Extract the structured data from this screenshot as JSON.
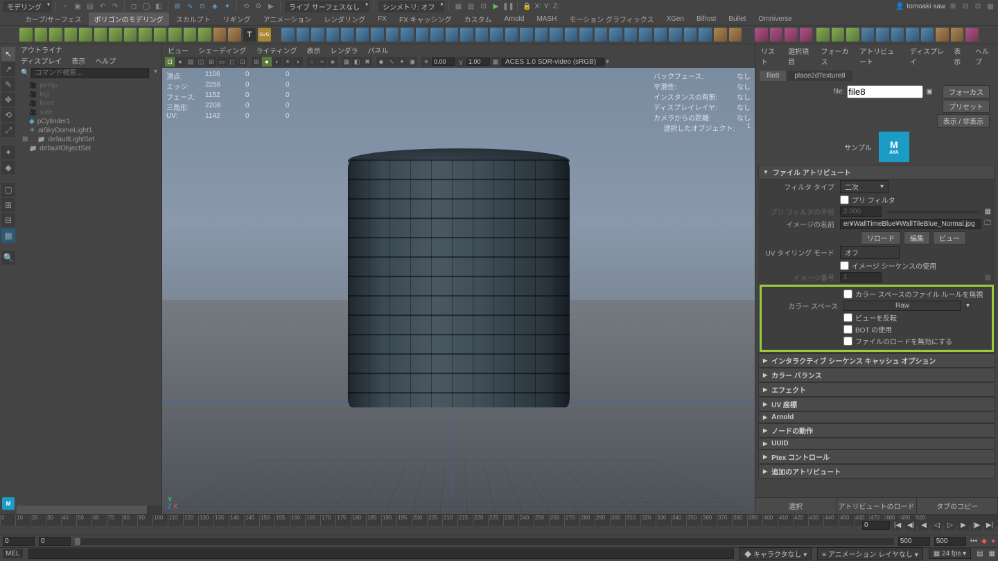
{
  "top": {
    "workspace": "モデリング",
    "surfaceMode": "ライブ サーフェスなし",
    "symmetry": "シンメトリ: オフ",
    "coordX": "X:",
    "coordY": "Y:",
    "coordZ": "Z:",
    "user": "tomoaki saw"
  },
  "menus": [
    "カーブ/サーフェス",
    "ポリゴンのモデリング",
    "スカルプト",
    "リギング",
    "アニメーション",
    "レンダリング",
    "FX",
    "FX キャッシング",
    "カスタム",
    "Arnold",
    "MASH",
    "モーション グラフィックス",
    "XGen",
    "Bifrost",
    "Bullet",
    "Omniverse"
  ],
  "menusActive": 1,
  "outliner": {
    "title": "アウトライナ",
    "menu": [
      "ディスプレイ",
      "表示",
      "ヘルプ"
    ],
    "searchPlaceholder": "コマンド検索...",
    "items": [
      {
        "icon": "cam",
        "label": "persp",
        "dim": true
      },
      {
        "icon": "cam",
        "label": "top",
        "dim": true
      },
      {
        "icon": "cam",
        "label": "front",
        "dim": true
      },
      {
        "icon": "cam",
        "label": "side",
        "dim": true
      },
      {
        "icon": "mesh",
        "label": "pCylinder1"
      },
      {
        "icon": "light",
        "label": "aiSkyDomeLight1"
      },
      {
        "icon": "set",
        "label": "defaultLightSet",
        "exp": true
      },
      {
        "icon": "set",
        "label": "defaultObjectSet"
      }
    ]
  },
  "viewport": {
    "menu": [
      "ビュー",
      "シェーディング",
      "ライティング",
      "表示",
      "レンダラ",
      "パネル"
    ],
    "exposure": "0.00",
    "gamma": "1.00",
    "colorSpace": "ACES 1.0 SDR-video (sRGB)",
    "hudL": [
      {
        "lbl": "頂点:",
        "a": "1106",
        "b": "0",
        "c": "0"
      },
      {
        "lbl": "エッジ:",
        "a": "2256",
        "b": "0",
        "c": "0"
      },
      {
        "lbl": "フェース:",
        "a": "1152",
        "b": "0",
        "c": "0"
      },
      {
        "lbl": "三角形:",
        "a": "2208",
        "b": "0",
        "c": "0"
      },
      {
        "lbl": "UV:",
        "a": "1142",
        "b": "0",
        "c": "0"
      }
    ],
    "hudR": [
      {
        "lbl": "バックフェース:",
        "v": "なし"
      },
      {
        "lbl": "平滑性:",
        "v": "なし"
      },
      {
        "lbl": "インスタンスの有無:",
        "v": "なし"
      },
      {
        "lbl": "ディスプレイレイヤ:",
        "v": "なし"
      },
      {
        "lbl": "カメラからの距離:",
        "v": "なし"
      },
      {
        "lbl": "選択したオブジェクト:",
        "v": "1"
      }
    ]
  },
  "attr": {
    "topmenu": [
      "リスト",
      "選択項目",
      "フォーカス",
      "アトリビュート",
      "ディスプレイ",
      "表示",
      "ヘルプ"
    ],
    "tabs": [
      "file8",
      "place2dTexture8"
    ],
    "fileLbl": "file:",
    "fileVal": "file8",
    "sideBtns": [
      "フォーカス",
      "プリセット",
      "表示 / 非表示"
    ],
    "sampleLbl": "サンプル",
    "logo": "M",
    "logoSub": "AYA",
    "sec1": "ファイル アトリビュート",
    "filterTypeLbl": "フィルタ タイプ",
    "filterType": "二次",
    "preFilter": "プリ フィルタ",
    "preFilterRadLbl": "プリ フィルタの半径",
    "preFilterRad": "2.000",
    "imgNameLbl": "イメージの名前",
    "imgName": "er¥WallTimeBlue¥WallTileBlue_Normal.jpg",
    "btns": [
      "リロード",
      "編集",
      "ビュー"
    ],
    "uvTileLbl": "UV タイリング モード",
    "uvTile": "オフ",
    "imgSeq": "イメージ シーケンスの使用",
    "imgNumLbl": "イメージ番号",
    "imgNum": "1",
    "ignoreRules": "カラー スペースのファイル ルールを無視",
    "csLbl": "カラー スペース",
    "csVal": "Raw",
    "flipView": "ビューを反転",
    "useBOT": "BOT の使用",
    "disableLoad": "ファイルのロードを無効にする",
    "sections": [
      "インタラクティブ シーケンス キャッシュ オプション",
      "カラー バランス",
      "エフェクト",
      "UV 座標",
      "Arnold",
      "ノードの動作",
      "UUID",
      "Ptex コントロール",
      "追加のアトリビュート"
    ],
    "bottom": [
      "選択",
      "アトリビュートのロード",
      "タブのコピー"
    ]
  },
  "time": {
    "start": "0",
    "startRange": "0",
    "end": "500",
    "endRange": "500",
    "endField": "500",
    "ticks": [
      "0",
      "10",
      "20",
      "30",
      "40",
      "50",
      "60",
      "70",
      "80",
      "90",
      "100",
      "110",
      "120",
      "130",
      "135",
      "140",
      "145",
      "150",
      "155",
      "160",
      "165",
      "170",
      "175",
      "180",
      "185",
      "190",
      "195",
      "200",
      "205",
      "210",
      "215",
      "220",
      "225",
      "230",
      "240",
      "250",
      "260",
      "270",
      "280",
      "290",
      "300",
      "310",
      "320",
      "330",
      "340",
      "350",
      "360",
      "370",
      "380",
      "390",
      "400",
      "410",
      "420",
      "430",
      "440",
      "450",
      "460",
      "470",
      "480",
      "490",
      "500"
    ]
  },
  "status": {
    "noChar": "キャラクタなし",
    "animLayer": "アニメーション レイヤなし",
    "fps": "24 fps"
  }
}
